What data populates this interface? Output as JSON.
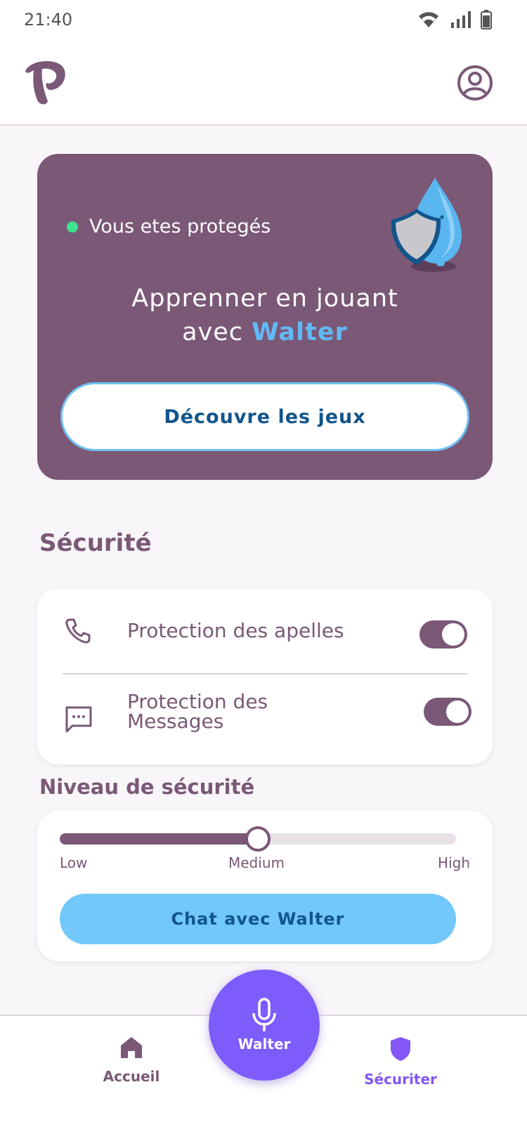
{
  "status_bar": {
    "time": "21:40"
  },
  "header": {
    "logo_icon": "brand-p-logo",
    "profile_icon": "user-circle-icon"
  },
  "hero": {
    "status_text": "Vous etes protegés",
    "title_line1": "Apprenner en jouant",
    "title_line2_prefix": "avec ",
    "title_line2_name": "Walter",
    "button_label": "Découvre les jeux",
    "colors": {
      "card_bg": "#7a5876",
      "status_dot": "#3de38f",
      "accent_name": "#62b9f5"
    }
  },
  "security": {
    "title": "Sécurité",
    "items": [
      {
        "label": "Protection des apelles",
        "icon": "phone-icon",
        "enabled": true
      },
      {
        "label": "Protection des Messages",
        "icon": "message-icon",
        "enabled": true
      }
    ]
  },
  "level": {
    "title": "Niveau de sécurité",
    "slider_value_fraction": 0.5,
    "labels": {
      "low": "Low",
      "medium": "Medium",
      "high": "High"
    },
    "chat_button": "Chat avec Walter"
  },
  "bottom_nav": {
    "home_label": "Accueil",
    "security_label": "Sécuriter",
    "mic_label": "Walter",
    "active": "security",
    "colors": {
      "active": "#8257f6",
      "inactive": "#7a5876",
      "fab": "#7e5cfb"
    }
  }
}
